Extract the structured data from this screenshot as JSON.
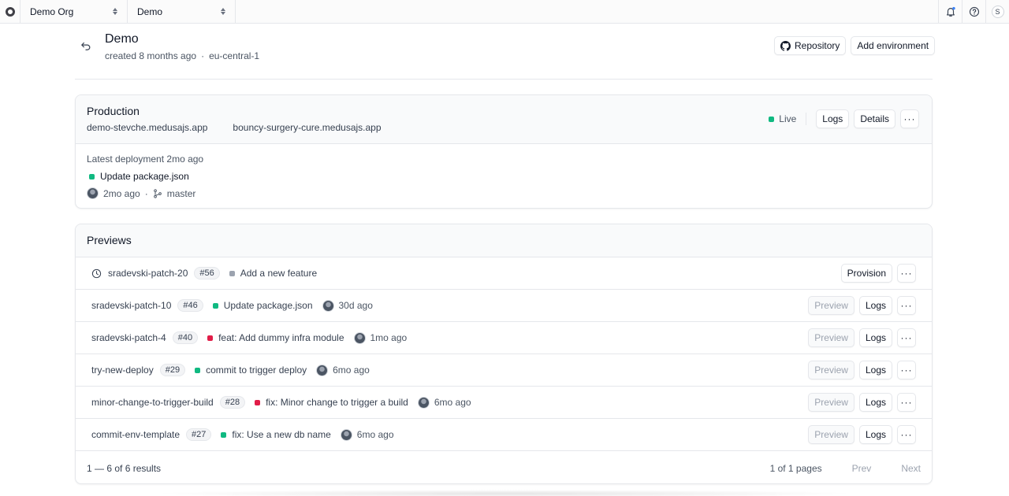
{
  "topbar": {
    "org": "Demo Org",
    "project": "Demo",
    "user_initial": "S"
  },
  "header": {
    "title": "Demo",
    "created": "created 8 months ago",
    "separator": "·",
    "region": "eu-central-1",
    "repository_label": "Repository",
    "add_environment_label": "Add environment"
  },
  "production": {
    "title": "Production",
    "domains": [
      "demo-stevche.medusajs.app",
      "bouncy-surgery-cure.medusajs.app"
    ],
    "status": "Live",
    "logs_label": "Logs",
    "details_label": "Details",
    "more_label": "···",
    "latest_deployment": "Latest deployment 2mo ago",
    "commit_message": "Update package.json",
    "age": "2mo ago",
    "separator": "·",
    "branch": "master"
  },
  "previews": {
    "title": "Previews",
    "provision_label": "Provision",
    "preview_label": "Preview",
    "logs_label": "Logs",
    "more_label": "···",
    "rows": [
      {
        "branch": "sradevski-patch-20",
        "pr": "#56",
        "status": "gray",
        "message": "Add a new feature",
        "age": ""
      },
      {
        "branch": "sradevski-patch-10",
        "pr": "#46",
        "status": "green",
        "message": "Update package.json",
        "age": "30d ago"
      },
      {
        "branch": "sradevski-patch-4",
        "pr": "#40",
        "status": "red",
        "message": "feat: Add dummy infra module",
        "age": "1mo ago"
      },
      {
        "branch": "try-new-deploy",
        "pr": "#29",
        "status": "green",
        "message": "commit to trigger deploy",
        "age": "6mo ago"
      },
      {
        "branch": "minor-change-to-trigger-build",
        "pr": "#28",
        "status": "red",
        "message": "fix: Minor change to trigger a build",
        "age": "6mo ago"
      },
      {
        "branch": "commit-env-template",
        "pr": "#27",
        "status": "green",
        "message": "fix: Use a new db name",
        "age": "6mo ago"
      }
    ],
    "results": "1 — 6 of 6 results",
    "pages": "1 of 1 pages",
    "prev": "Prev",
    "next": "Next"
  },
  "colors": {
    "green": "#10b981",
    "red": "#e11d48",
    "gray": "#9ca3af"
  },
  "icons": {
    "logo": "medusa-logo-icon",
    "switcher": "chevron-up-down-icon",
    "notifications": "bell-icon",
    "help": "question-circle-icon",
    "back": "arrow-uturn-left-icon",
    "repository": "github-icon",
    "branch": "git-branch-icon",
    "pending": "clock-icon"
  }
}
